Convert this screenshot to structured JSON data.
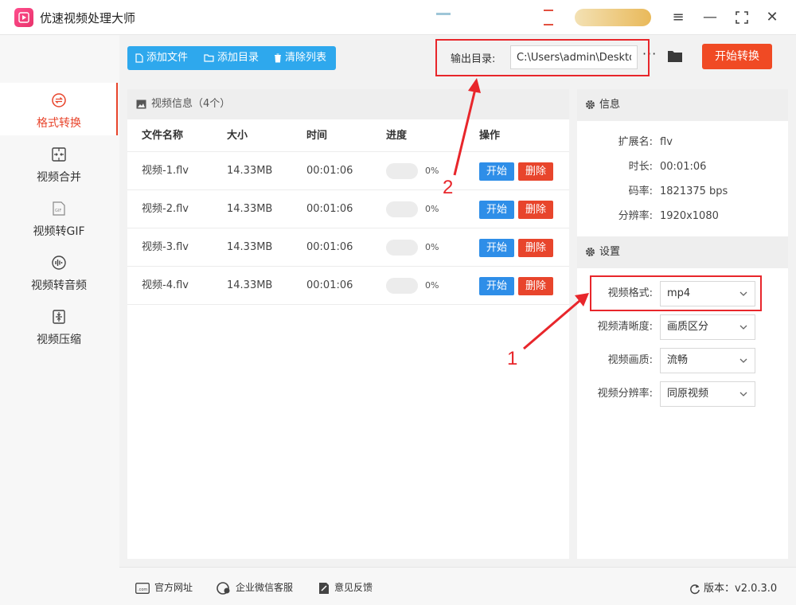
{
  "app": {
    "title": "优速视频处理大师",
    "colors": {
      "accent": "#f04a24",
      "toolbar_blue": "#2ea8ed",
      "start_blue": "#2e8ee8",
      "delete_red": "#e8452c",
      "highlight": "#e8262b"
    }
  },
  "window_controls": {
    "menu": "≡",
    "minimize": "—",
    "maximize": "⛶",
    "close": "✕"
  },
  "sidebar": {
    "items": [
      {
        "label": "格式转换",
        "icon": "swap-circle-icon",
        "active": true
      },
      {
        "label": "视频合并",
        "icon": "merge-icon",
        "active": false
      },
      {
        "label": "视频转GIF",
        "icon": "gif-file-icon",
        "active": false
      },
      {
        "label": "视频转音频",
        "icon": "audio-wave-icon",
        "active": false
      },
      {
        "label": "视频压缩",
        "icon": "compress-icon",
        "active": false
      }
    ]
  },
  "toolbar": {
    "add_file": "添加文件",
    "add_dir": "添加目录",
    "clear_list": "清除列表",
    "output_label": "输出目录:",
    "output_path": "C:\\Users\\admin\\Deskto",
    "dots": "···",
    "start_convert": "开始转换"
  },
  "main": {
    "header": "视频信息（4个）",
    "columns": [
      "文件名称",
      "大小",
      "时间",
      "进度",
      "操作"
    ],
    "rows": [
      {
        "name": "视频-1.flv",
        "size": "14.33MB",
        "time": "00:01:06",
        "progress_pct": 0,
        "progress_text": "0%",
        "start": "开始",
        "delete": "删除"
      },
      {
        "name": "视频-2.flv",
        "size": "14.33MB",
        "time": "00:01:06",
        "progress_pct": 0,
        "progress_text": "0%",
        "start": "开始",
        "delete": "删除"
      },
      {
        "name": "视频-3.flv",
        "size": "14.33MB",
        "time": "00:01:06",
        "progress_pct": 0,
        "progress_text": "0%",
        "start": "开始",
        "delete": "删除"
      },
      {
        "name": "视频-4.flv",
        "size": "14.33MB",
        "time": "00:01:06",
        "progress_pct": 0,
        "progress_text": "0%",
        "start": "开始",
        "delete": "删除"
      }
    ]
  },
  "info": {
    "header": "信息",
    "fields": [
      {
        "label": "扩展名:",
        "value": "flv"
      },
      {
        "label": "时长:",
        "value": "00:01:06"
      },
      {
        "label": "码率:",
        "value": "1821375 bps"
      },
      {
        "label": "分辨率:",
        "value": "1920x1080"
      }
    ]
  },
  "settings": {
    "header": "设置",
    "fields": [
      {
        "label": "视频格式:",
        "value": "mp4"
      },
      {
        "label": "视频清晰度:",
        "value": "画质区分"
      },
      {
        "label": "视频画质:",
        "value": "流畅"
      },
      {
        "label": "视频分辨率:",
        "value": "同原视频"
      }
    ]
  },
  "annotations": {
    "one": "1",
    "two": "2"
  },
  "footer": {
    "website": "官方网址",
    "wechat": "企业微信客服",
    "feedback": "意见反馈",
    "version": "版本：v2.0.3.0"
  }
}
